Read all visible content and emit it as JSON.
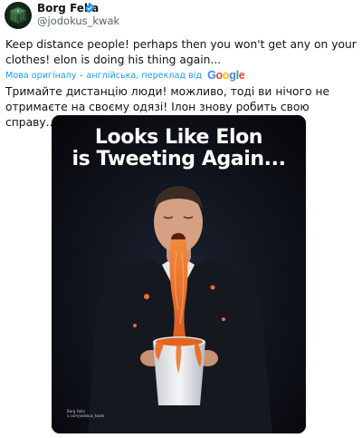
{
  "author": {
    "name": "Borg Fella",
    "handle": "@jodokus_kwak",
    "verified": true,
    "avatar_icon": "borg-cube-avatar"
  },
  "tweet": {
    "text": "Keep distance people! perhaps then you won't get any on your clothes! elon is doing his thing again...",
    "translation_label": "Мова оригіналу – англійська, переклад від",
    "translation_provider": "Google",
    "translated_text": "Тримайте дистанцію люди! можливо, тоді ви нічого не отримаєте на своєму одязі! Ілон знову робить свою справу..."
  },
  "media": {
    "caption_line1": "Looks Like Elon",
    "caption_line2": "is Tweeting Again...",
    "watermark_line1": "Borg Fella",
    "watermark_line2": "x.com/jodokus_kwak"
  },
  "colors": {
    "text": "#0f1419",
    "secondary": "#536471",
    "link": "#1d9bf0",
    "verified": "#1d9bf0",
    "media_bg": "#0b0d12",
    "spaghetti": "#e8702a"
  }
}
